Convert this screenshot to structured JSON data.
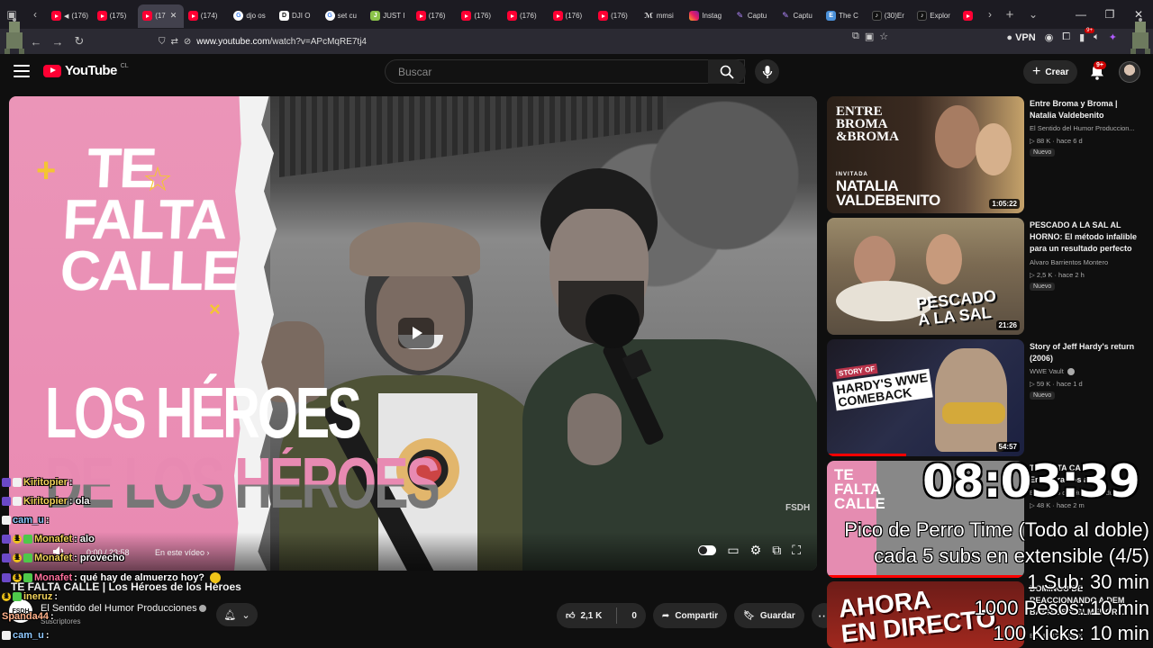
{
  "browser": {
    "tabs": [
      {
        "icon": "youtube-icon",
        "label": "(176)",
        "active": false,
        "muted": true
      },
      {
        "icon": "youtube-icon",
        "label": "(175)",
        "active": false
      },
      {
        "icon": "youtube-icon",
        "label": "(17",
        "active": true
      },
      {
        "icon": "youtube-icon",
        "label": "(174)",
        "active": false
      },
      {
        "icon": "google-icon",
        "label": "djo os",
        "active": false
      },
      {
        "icon": "dji-icon",
        "label": "DJI O",
        "active": false
      },
      {
        "icon": "google-icon",
        "label": "set cu",
        "active": false
      },
      {
        "icon": "just-icon",
        "label": "JUST I",
        "active": false
      },
      {
        "icon": "youtube-icon",
        "label": "(176)",
        "active": false
      },
      {
        "icon": "youtube-icon",
        "label": "(176)",
        "active": false
      },
      {
        "icon": "youtube-icon",
        "label": "(176)",
        "active": false
      },
      {
        "icon": "youtube-icon",
        "label": "(176)",
        "active": false
      },
      {
        "icon": "youtube-icon",
        "label": "(176)",
        "active": false
      },
      {
        "icon": "mm-icon",
        "label": "mmsi",
        "active": false
      },
      {
        "icon": "instagram-icon",
        "label": "Instag",
        "active": false
      },
      {
        "icon": "capture-icon",
        "label": "Captu",
        "active": false
      },
      {
        "icon": "capture-icon",
        "label": "Captu",
        "active": false
      },
      {
        "icon": "economist-icon",
        "label": "The C",
        "active": false
      },
      {
        "icon": "tiktok-icon",
        "label": "(30)Er",
        "active": false
      },
      {
        "icon": "tiktok-icon",
        "label": "Explor",
        "active": false
      },
      {
        "icon": "youtube-icon",
        "label": "",
        "active": false
      }
    ],
    "url_host": "www.youtube.com",
    "url_path": "/watch?v=APcMqRE7tj4",
    "vpn_label": "VPN",
    "notif_count": "9+"
  },
  "youtube": {
    "logo_text": "YouTube",
    "country": "CL",
    "search_placeholder": "Buscar",
    "create_label": "Crear",
    "bell_badge": "9+"
  },
  "player": {
    "thumb_top": [
      "TE",
      "FALTA",
      "CALLE"
    ],
    "thumb_big": [
      "LOS HÉROES",
      "DE LOS HÉROES"
    ],
    "watermark": "FSDH",
    "time": "0:00 / 23:58",
    "chapter": "En este vídeo"
  },
  "video": {
    "title": "TE FALTA CALLE | Los Héroes de los Héroes",
    "channel": "El Sentido del Humor Producciones",
    "subscribers": "Suscriptores",
    "likes": "2,1 K",
    "dislikes": "0",
    "share_label": "Compartir",
    "save_label": "Guardar"
  },
  "recommendations": [
    {
      "title": "Entre Broma y Broma | Natalia Valdebenito",
      "channel": "El Sentido del Humor Produccion...",
      "meta": "88 K · hace 6 d",
      "badge": "Nuevo",
      "duration": "1:05:22",
      "thumb_lines": [
        "ENTRE",
        "BROMA",
        "&BROMA"
      ],
      "thumb_inv": "INVITADA",
      "thumb_name": [
        "NATALIA",
        "VALDEBENITO"
      ]
    },
    {
      "title": "PESCADO A LA SAL AL HORNO: El método infalible para un resultado perfecto",
      "channel": "Alvaro Barrientos Montero",
      "meta": "2,5 K · hace 2 h",
      "badge": "Nuevo",
      "duration": "21:26",
      "thumb_text": [
        "PESCADO",
        "A LA SAL"
      ]
    },
    {
      "title": "Story of Jeff Hardy's return (2006)",
      "channel": "WWE Vault",
      "meta": "59 K · hace 1 d",
      "badge": "Nuevo",
      "duration": "54:57",
      "thumb_tag": "STORY OF",
      "thumb_text": [
        "HARDY'S WWE",
        "COMEBACK"
      ]
    },
    {
      "title": "TE FALTA CALLE | Encontramos a Pe...",
      "channel": "El Sentido del Humor Produccion...",
      "meta": "48 K · hace 2 m",
      "thumb_text": [
        "TE",
        "FALTA",
        "CALLE"
      ]
    },
    {
      "title": "DOMINGO DE REACCIONANDO A DEM BATTLES Y GLMENOR...",
      "channel": "EL MENTAL MAX",
      "thumb_text": [
        "AHORA",
        "EN DIRECTO"
      ]
    }
  ],
  "chat": [
    {
      "user": "Kiritopier",
      "msg": ":",
      "color": "yellow",
      "badges": [
        "p",
        "w"
      ]
    },
    {
      "user": "Kiritopier",
      "msg": ": ola",
      "color": "yellow",
      "badges": [
        "p",
        "w"
      ]
    },
    {
      "user": "cam_u",
      "msg": ":",
      "color": "blue",
      "badges": [
        "w"
      ]
    },
    {
      "user": "Monafet",
      "msg": ": alo",
      "color": "yellow",
      "badges": [
        "p",
        "y",
        "g"
      ]
    },
    {
      "user": "Monafet",
      "msg": ": provecho",
      "color": "yellow",
      "badges": [
        "p",
        "y",
        "g"
      ]
    },
    {
      "user": "Monafet",
      "msg": ": qué hay de almuerzo hoy?",
      "color": "pink",
      "badges": [
        "p",
        "y",
        "g"
      ]
    },
    {
      "user": "ineruz",
      "msg": ":",
      "color": "yellow",
      "badges": [
        "y",
        "g"
      ]
    },
    {
      "user": "Spanda44",
      "msg": ":",
      "color": "peach",
      "badges": []
    },
    {
      "user": "cam_u",
      "msg": ":",
      "color": "blue",
      "badges": [
        "w"
      ]
    }
  ],
  "overlay": {
    "timer": "08:03:39",
    "lines": [
      "Pico de Perro Time (Todo al doble)",
      "cada 5 subs en extensible (4/5)",
      "1 Sub: 30 min",
      "1000 Pesos: 10 min",
      "100 Kicks: 10 min"
    ]
  },
  "colors": {
    "background": "#0f0f0f",
    "brand_red": "#ff0033",
    "thumb_pink": "#e98ab2",
    "chat_yellow": "#f2d35b"
  }
}
